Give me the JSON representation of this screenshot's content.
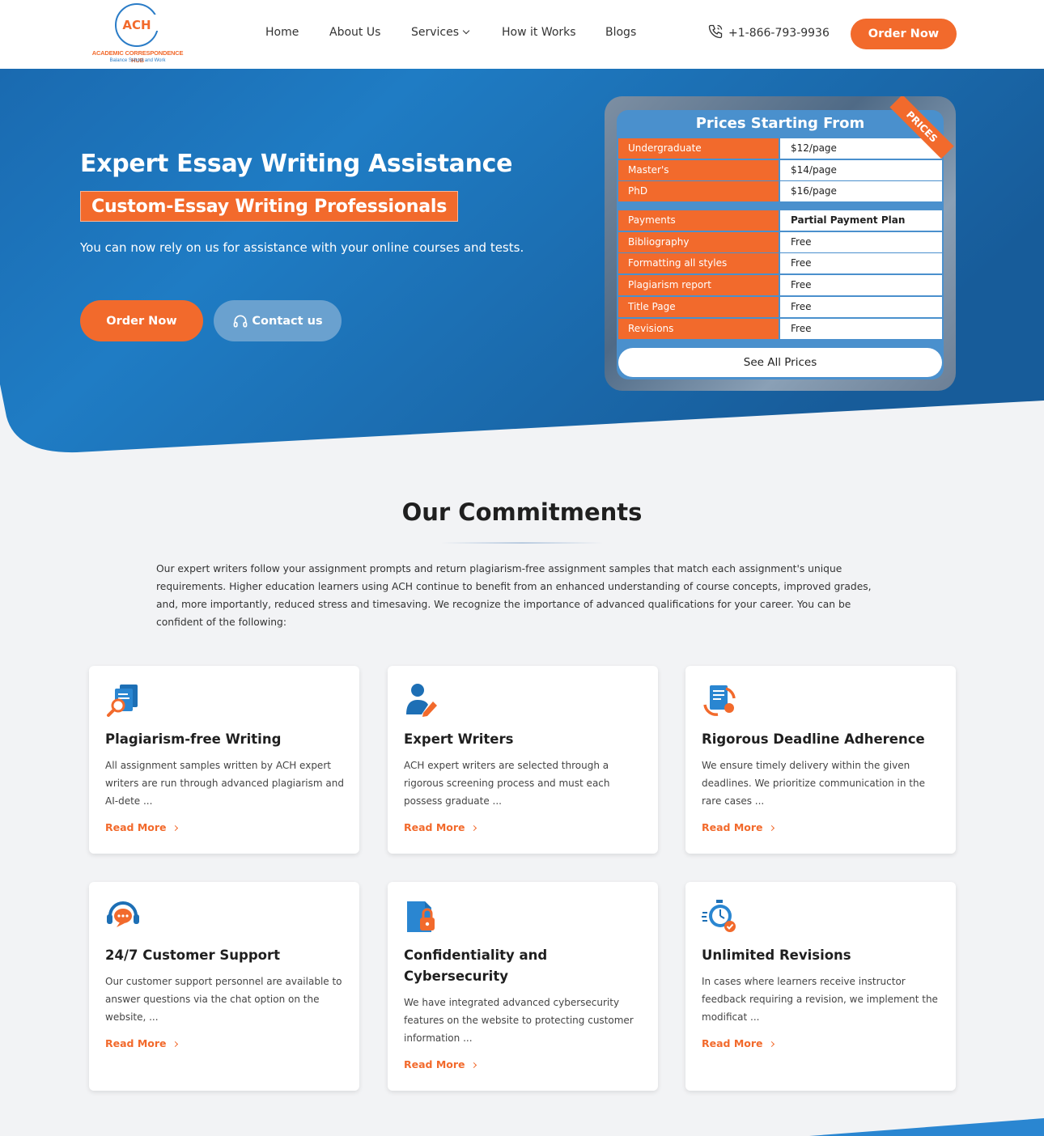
{
  "brand": {
    "abbr": "ACH",
    "name": "ACADEMIC CORRESPONDENCE HUB",
    "tagline": "Balance School and Work"
  },
  "nav": {
    "items": [
      "Home",
      "About Us",
      "Services",
      "How it Works",
      "Blogs"
    ],
    "phone": "+1-866-793-9936",
    "order_label": "Order Now"
  },
  "hero": {
    "title": "Expert Essay Writing Assistance",
    "subtitle": "Custom-Essay Writing Professionals",
    "description": "You can now rely on us for assistance with your online courses and tests.",
    "order_label": "Order Now",
    "contact_label": "Contact us"
  },
  "prices": {
    "title": "Prices Starting From",
    "ribbon": "PRICES",
    "levels": [
      {
        "label": "Undergraduate",
        "value": "$12/page"
      },
      {
        "label": "Master's",
        "value": "$14/page"
      },
      {
        "label": "PhD",
        "value": "$16/page"
      }
    ],
    "features": [
      {
        "label": "Payments",
        "value": "Partial Payment Plan"
      },
      {
        "label": "Bibliography",
        "value": "Free"
      },
      {
        "label": "Formatting all styles",
        "value": "Free"
      },
      {
        "label": "Plagiarism report",
        "value": "Free"
      },
      {
        "label": "Title Page",
        "value": "Free"
      },
      {
        "label": "Revisions",
        "value": "Free"
      }
    ],
    "see_all_label": "See All Prices"
  },
  "commitments": {
    "title": "Our Commitments",
    "description": "Our expert writers follow your assignment prompts and return plagiarism-free assignment samples that match each assignment's unique requirements. Higher education learners using ACH continue to benefit from an enhanced understanding of course concepts, improved grades, and, more importantly, reduced stress and timesaving. We recognize the importance of advanced qualifications for your career. You can be confident of the following:",
    "read_more": "Read More",
    "cards": [
      {
        "icon": "plagiarism-check-icon",
        "title": "Plagiarism-free Writing",
        "text": "All assignment samples written by ACH expert writers are run through advanced plagiarism and AI-dete ..."
      },
      {
        "icon": "expert-writer-icon",
        "title": "Expert Writers",
        "text": "ACH expert writers are selected through a rigorous screening process and must each possess graduate  ..."
      },
      {
        "icon": "deadline-document-icon",
        "title": "Rigorous Deadline Adherence",
        "text": "We ensure timely delivery within the given deadlines. We prioritize communication in the rare cases  ..."
      },
      {
        "icon": "customer-support-icon",
        "title": "24/7 Customer Support",
        "text": "Our customer support personnel are available to answer questions via the chat option on the website, ..."
      },
      {
        "icon": "secure-file-lock-icon",
        "title": "Confidentiality and Cybersecurity",
        "text": "We have integrated advanced cybersecurity features on the website to protecting customer information ..."
      },
      {
        "icon": "stopwatch-revision-icon",
        "title": "Unlimited Revisions",
        "text": "In cases where learners receive instructor feedback requiring a revision, we implement the modificat ..."
      }
    ]
  },
  "colors": {
    "accent": "#f26a2c",
    "primary_blue": "#1d6fb5",
    "background": "#f2f3f5"
  }
}
